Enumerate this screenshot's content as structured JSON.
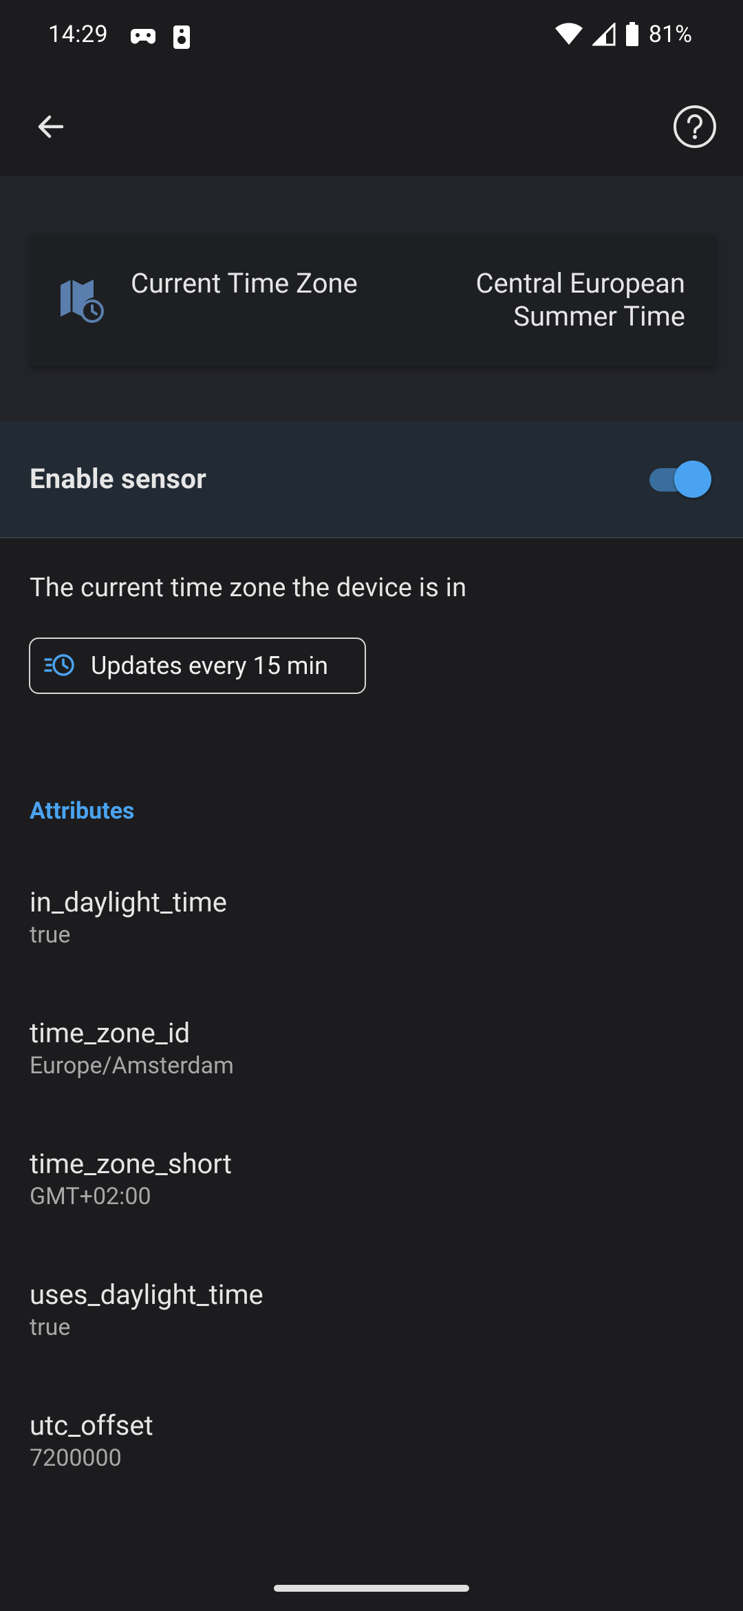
{
  "status_bar": {
    "time": "14:29",
    "battery": "81%"
  },
  "app_bar": {
    "back_icon": "arrow-left-icon",
    "help_icon": "help-circle-icon"
  },
  "sensor": {
    "name": "Current Time Zone",
    "state": "Central European Summer Time",
    "icon": "map-clock-icon"
  },
  "enable_row": {
    "label": "Enable sensor",
    "enabled": true
  },
  "description": "The current time zone the device is in",
  "update_chip": {
    "label": "Updates every 15 min",
    "icon": "update-clock-icon"
  },
  "attributes": {
    "heading": "Attributes",
    "items": [
      {
        "name": "in_daylight_time",
        "value": "true"
      },
      {
        "name": "time_zone_id",
        "value": "Europe/Amsterdam"
      },
      {
        "name": "time_zone_short",
        "value": "GMT+02:00"
      },
      {
        "name": "uses_daylight_time",
        "value": "true"
      },
      {
        "name": "utc_offset",
        "value": "7200000"
      }
    ]
  },
  "colors": {
    "accent": "#4aa3f0",
    "background": "#1c1c1e",
    "header_bg": "#23242a",
    "enable_row_bg": "#222a33"
  }
}
